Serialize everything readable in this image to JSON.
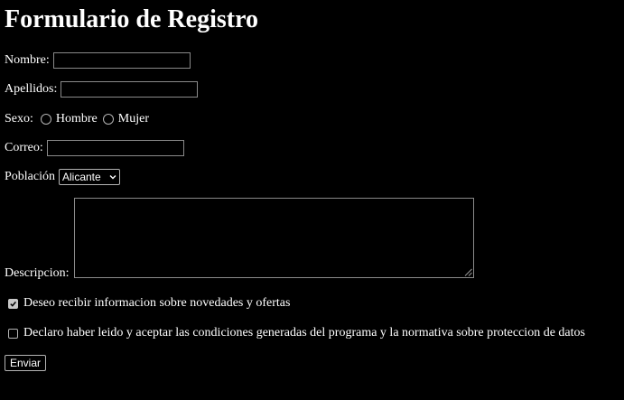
{
  "form": {
    "title": "Formulario de Registro",
    "nombre": {
      "label": "Nombre:",
      "value": ""
    },
    "apellidos": {
      "label": "Apellidos:",
      "value": ""
    },
    "sexo": {
      "label": "Sexo:",
      "options": [
        "Hombre",
        "Mujer"
      ],
      "selected": null
    },
    "correo": {
      "label": "Correo:",
      "value": ""
    },
    "poblacion": {
      "label": "Población",
      "selected": "Alicante"
    },
    "descripcion": {
      "label": "Descripcion:",
      "value": ""
    },
    "novedades": {
      "label": "Deseo recibir informacion sobre novedades y ofertas",
      "checked": true
    },
    "condiciones": {
      "label": "Declaro haber leido y aceptar las condiciones generadas del programa y la normativa sobre proteccion de datos",
      "checked": false
    },
    "submit_label": "Enviar"
  },
  "icons": {
    "select_arrow": "chevron-down-icon",
    "checkmark": "checkmark-icon",
    "resize": "resize-grip-icon"
  },
  "colors": {
    "background": "#000000",
    "text": "#ffffff",
    "control_border": "#8a8a8a",
    "checked_fill": "#c8c8c8"
  }
}
